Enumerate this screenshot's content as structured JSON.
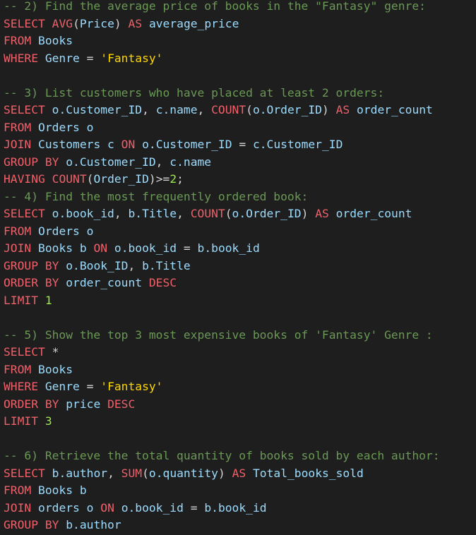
{
  "editor": {
    "lines": [
      [
        {
          "t": "-- 2) Find the average price of books in the \"Fantasy\" genre:",
          "c": "cm"
        }
      ],
      [
        {
          "t": "SELECT",
          "c": "kw"
        },
        {
          "t": " ",
          "c": "sp"
        },
        {
          "t": "AVG",
          "c": "fn"
        },
        {
          "t": "(",
          "c": "pn"
        },
        {
          "t": "Price",
          "c": "id"
        },
        {
          "t": ")",
          "c": "pn"
        },
        {
          "t": " ",
          "c": "sp"
        },
        {
          "t": "AS",
          "c": "kw"
        },
        {
          "t": " ",
          "c": "sp"
        },
        {
          "t": "average_price",
          "c": "id"
        }
      ],
      [
        {
          "t": "FROM",
          "c": "kw"
        },
        {
          "t": " ",
          "c": "sp"
        },
        {
          "t": "Books",
          "c": "id"
        }
      ],
      [
        {
          "t": "WHERE",
          "c": "kw"
        },
        {
          "t": " ",
          "c": "sp"
        },
        {
          "t": "Genre",
          "c": "id"
        },
        {
          "t": " = ",
          "c": "op"
        },
        {
          "t": "'Fantasy'",
          "c": "str"
        }
      ],
      [],
      [
        {
          "t": "-- 3) List customers who have placed at least 2 orders:",
          "c": "cm"
        }
      ],
      [
        {
          "t": "SELECT",
          "c": "kw"
        },
        {
          "t": " ",
          "c": "sp"
        },
        {
          "t": "o.Customer_ID",
          "c": "id"
        },
        {
          "t": ", ",
          "c": "pn"
        },
        {
          "t": "c.name",
          "c": "id"
        },
        {
          "t": ", ",
          "c": "pn"
        },
        {
          "t": "COUNT",
          "c": "fn"
        },
        {
          "t": "(",
          "c": "pn"
        },
        {
          "t": "o.Order_ID",
          "c": "id"
        },
        {
          "t": ")",
          "c": "pn"
        },
        {
          "t": " ",
          "c": "sp"
        },
        {
          "t": "AS",
          "c": "kw"
        },
        {
          "t": " ",
          "c": "sp"
        },
        {
          "t": "order_count",
          "c": "id"
        }
      ],
      [
        {
          "t": "FROM",
          "c": "kw"
        },
        {
          "t": " ",
          "c": "sp"
        },
        {
          "t": "Orders o",
          "c": "id"
        }
      ],
      [
        {
          "t": "JOIN",
          "c": "kw"
        },
        {
          "t": " ",
          "c": "sp"
        },
        {
          "t": "Customers c",
          "c": "id"
        },
        {
          "t": " ",
          "c": "sp"
        },
        {
          "t": "ON",
          "c": "kw"
        },
        {
          "t": " ",
          "c": "sp"
        },
        {
          "t": "o.Customer_ID",
          "c": "id"
        },
        {
          "t": " = ",
          "c": "op"
        },
        {
          "t": "c.Customer_ID",
          "c": "id"
        }
      ],
      [
        {
          "t": "GROUP BY",
          "c": "kw"
        },
        {
          "t": " ",
          "c": "sp"
        },
        {
          "t": "o.Customer_ID",
          "c": "id"
        },
        {
          "t": ", ",
          "c": "pn"
        },
        {
          "t": "c.name",
          "c": "id"
        }
      ],
      [
        {
          "t": "HAVING",
          "c": "kw"
        },
        {
          "t": " ",
          "c": "sp"
        },
        {
          "t": "COUNT",
          "c": "fn"
        },
        {
          "t": "(",
          "c": "pn"
        },
        {
          "t": "Order_ID",
          "c": "id"
        },
        {
          "t": ")>=",
          "c": "op"
        },
        {
          "t": "2",
          "c": "num"
        },
        {
          "t": ";",
          "c": "pn"
        }
      ],
      [
        {
          "t": "-- 4) Find the most frequently ordered book:",
          "c": "cm"
        }
      ],
      [
        {
          "t": "SELECT",
          "c": "kw"
        },
        {
          "t": " ",
          "c": "sp"
        },
        {
          "t": "o.book_id",
          "c": "id"
        },
        {
          "t": ", ",
          "c": "pn"
        },
        {
          "t": "b.Title",
          "c": "id"
        },
        {
          "t": ", ",
          "c": "pn"
        },
        {
          "t": "COUNT",
          "c": "fn"
        },
        {
          "t": "(",
          "c": "pn"
        },
        {
          "t": "o.Order_ID",
          "c": "id"
        },
        {
          "t": ")",
          "c": "pn"
        },
        {
          "t": " ",
          "c": "sp"
        },
        {
          "t": "AS",
          "c": "kw"
        },
        {
          "t": " ",
          "c": "sp"
        },
        {
          "t": "order_count",
          "c": "id"
        }
      ],
      [
        {
          "t": "FROM",
          "c": "kw"
        },
        {
          "t": " ",
          "c": "sp"
        },
        {
          "t": "Orders o",
          "c": "id"
        }
      ],
      [
        {
          "t": "JOIN",
          "c": "kw"
        },
        {
          "t": " ",
          "c": "sp"
        },
        {
          "t": "Books b",
          "c": "id"
        },
        {
          "t": " ",
          "c": "sp"
        },
        {
          "t": "ON",
          "c": "kw"
        },
        {
          "t": " ",
          "c": "sp"
        },
        {
          "t": "o.book_id",
          "c": "id"
        },
        {
          "t": " = ",
          "c": "op"
        },
        {
          "t": "b.book_id",
          "c": "id"
        }
      ],
      [
        {
          "t": "GROUP BY",
          "c": "kw"
        },
        {
          "t": " ",
          "c": "sp"
        },
        {
          "t": "o.Book_ID",
          "c": "id"
        },
        {
          "t": ", ",
          "c": "pn"
        },
        {
          "t": "b.Title",
          "c": "id"
        }
      ],
      [
        {
          "t": "ORDER BY",
          "c": "kw"
        },
        {
          "t": " ",
          "c": "sp"
        },
        {
          "t": "order_count",
          "c": "id"
        },
        {
          "t": " ",
          "c": "sp"
        },
        {
          "t": "DESC",
          "c": "kw"
        }
      ],
      [
        {
          "t": "LIMIT",
          "c": "kw"
        },
        {
          "t": " ",
          "c": "sp"
        },
        {
          "t": "1",
          "c": "num"
        }
      ],
      [],
      [
        {
          "t": "-- 5) Show the top 3 most expensive books of 'Fantasy' Genre :",
          "c": "cm"
        }
      ],
      [
        {
          "t": "SELECT",
          "c": "kw"
        },
        {
          "t": " ",
          "c": "sp"
        },
        {
          "t": "*",
          "c": "op"
        }
      ],
      [
        {
          "t": "FROM",
          "c": "kw"
        },
        {
          "t": " ",
          "c": "sp"
        },
        {
          "t": "Books",
          "c": "id"
        }
      ],
      [
        {
          "t": "WHERE",
          "c": "kw"
        },
        {
          "t": " ",
          "c": "sp"
        },
        {
          "t": "Genre",
          "c": "id"
        },
        {
          "t": " = ",
          "c": "op"
        },
        {
          "t": "'Fantasy'",
          "c": "str"
        }
      ],
      [
        {
          "t": "ORDER BY",
          "c": "kw"
        },
        {
          "t": " ",
          "c": "sp"
        },
        {
          "t": "price",
          "c": "id"
        },
        {
          "t": " ",
          "c": "sp"
        },
        {
          "t": "DESC",
          "c": "kw"
        }
      ],
      [
        {
          "t": "LIMIT",
          "c": "kw"
        },
        {
          "t": " ",
          "c": "sp"
        },
        {
          "t": "3",
          "c": "num"
        }
      ],
      [],
      [
        {
          "t": "-- 6) Retrieve the total quantity of books sold by each author:",
          "c": "cm"
        }
      ],
      [
        {
          "t": "SELECT",
          "c": "kw"
        },
        {
          "t": " ",
          "c": "sp"
        },
        {
          "t": "b.author",
          "c": "id"
        },
        {
          "t": ", ",
          "c": "pn"
        },
        {
          "t": "SUM",
          "c": "fn"
        },
        {
          "t": "(",
          "c": "pn"
        },
        {
          "t": "o.quantity",
          "c": "id"
        },
        {
          "t": ")",
          "c": "pn"
        },
        {
          "t": " ",
          "c": "sp"
        },
        {
          "t": "AS",
          "c": "kw"
        },
        {
          "t": " ",
          "c": "sp"
        },
        {
          "t": "Total_books_sold",
          "c": "id"
        }
      ],
      [
        {
          "t": "FROM",
          "c": "kw"
        },
        {
          "t": " ",
          "c": "sp"
        },
        {
          "t": "Books b",
          "c": "id"
        }
      ],
      [
        {
          "t": "JOIN",
          "c": "kw"
        },
        {
          "t": " ",
          "c": "sp"
        },
        {
          "t": "orders o",
          "c": "id"
        },
        {
          "t": " ",
          "c": "sp"
        },
        {
          "t": "ON",
          "c": "kw"
        },
        {
          "t": " ",
          "c": "sp"
        },
        {
          "t": "o.book_id",
          "c": "id"
        },
        {
          "t": " = ",
          "c": "op"
        },
        {
          "t": "b.book_id",
          "c": "id"
        }
      ],
      [
        {
          "t": "GROUP BY",
          "c": "kw"
        },
        {
          "t": " ",
          "c": "sp"
        },
        {
          "t": "b.author",
          "c": "id"
        }
      ]
    ]
  },
  "theme": {
    "background": "#1e1e1e",
    "comment": "#6a9955",
    "keyword": "#f0606a",
    "identifier": "#9cdcfe",
    "string": "#ffd700",
    "number": "#9ee84f",
    "operator": "#d4d4d4"
  }
}
